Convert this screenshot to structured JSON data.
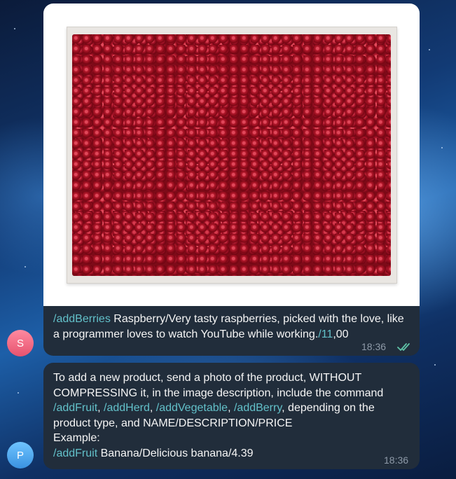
{
  "messages": [
    {
      "avatar_letter": "S",
      "avatar_colors": [
        "#ff8aa0",
        "#e6536f"
      ],
      "photo_description": "crate of red berries",
      "caption": {
        "command": "/addBerries",
        "text": " Raspberry/Very tasty raspberries, picked with the love, like a programmer loves to watch YouTube while working.",
        "price_slash": "/11",
        "price_rest": ",00"
      },
      "time": "18:36",
      "status_icon": "double-check-icon"
    },
    {
      "avatar_letter": "P",
      "avatar_colors": [
        "#6fc4ff",
        "#3a92e0"
      ],
      "text_intro": "To add a new product, send a photo of the product, WITHOUT COMPRESSING it, in the image description, include the command ",
      "commands": [
        "/addFruit",
        "/addHerd",
        "/addVegetable",
        "/addBerry"
      ],
      "separator": ", ",
      "text_after": ", depending on the product type, and NAME/DESCRIPTION/PRICE",
      "example_label": "Example:",
      "example_command": "/addFruit",
      "example_text": " Banana/Delicious banana/4.39",
      "time": "18:36"
    }
  ],
  "colors": {
    "bubble": "#212d3b",
    "command_link": "#62c0c9",
    "timestamp": "#8e9aa8",
    "text": "#f5f5f5"
  }
}
